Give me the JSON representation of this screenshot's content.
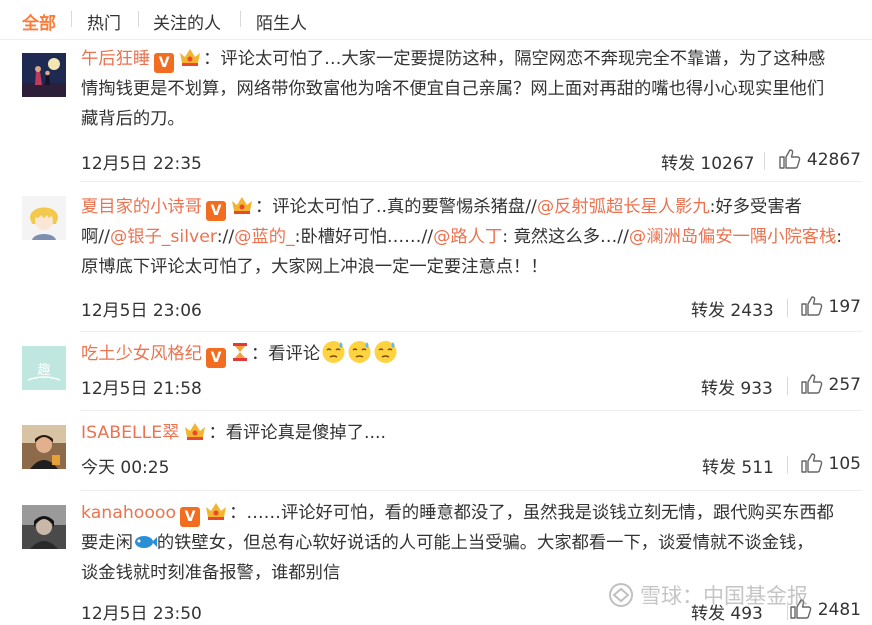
{
  "tabs": [
    {
      "label": "全部",
      "active": true
    },
    {
      "label": "热门",
      "active": false
    },
    {
      "label": "关注的人",
      "active": false
    },
    {
      "label": "陌生人",
      "active": false
    }
  ],
  "colors": {
    "accent": "#fa7d3c",
    "username": "#eb7350",
    "vip_badge": "#f26d1f"
  },
  "comments": [
    {
      "user": "午后狂睡",
      "line1": "：评论太可怕了…大家一定要提防这种，隔空网恋不奔现完全不靠谱，为了这种感",
      "line2": "情掏钱更是不划算，网络带你致富他为啥不便宜自己亲属？网上面对再甜的嘴也得小心现实里他们",
      "line3": "藏背后的刀。",
      "time": "12月5日 22:35",
      "repost": "转发 10267",
      "likes": "42867"
    },
    {
      "user": "夏目家的小诗哥",
      "l1_text": "：评论太可怕了..真的要警惕杀猪盘//",
      "l1_mention": "@反射弧超长星人影九",
      "l1_tail": ":好多受害者",
      "l2_a": "啊//",
      "l2_m1": "@银子_silver",
      "l2_b": "://",
      "l2_m2": "@蓝的_",
      "l2_c": ":卧槽好可怕……//",
      "l2_m3": "@路人丁",
      "l2_d": ": 竟然这么多…//",
      "l2_m4": "@澜洲岛偏安一隅小院客栈",
      "l2_e": ":",
      "line3": "原博底下评论太可怕了，大家网上冲浪一定一定要注意点！！",
      "time": "12月5日 23:06",
      "repost": "转发 2433",
      "likes": "197"
    },
    {
      "user": "吃土少女风格纪",
      "text": "：看评论",
      "time": "12月5日 21:58",
      "repost": "转发 933",
      "likes": "257"
    },
    {
      "user": "ISABELLE翠",
      "text": "：看评论真是傻掉了....",
      "time": "今天 00:25",
      "repost": "转发 511",
      "likes": "105"
    },
    {
      "user": "kanahoooo",
      "line1": "：……评论好可怕，看的睡意都没了，虽然我是谈钱立刻无情，跟代购买东西都",
      "line2a": "要走闲",
      "line2b": "的铁壁女，但总有心软好说话的人可能上当受骗。大家都看一下，谈爱情就不谈金钱，",
      "line3": "谈金钱就时刻准备报警，谁都别信",
      "time": "12月5日 23:50",
      "repost": "转发 493",
      "likes": "2481"
    }
  ],
  "badge_letter": "V",
  "watermark": "雪球：中国基金报"
}
